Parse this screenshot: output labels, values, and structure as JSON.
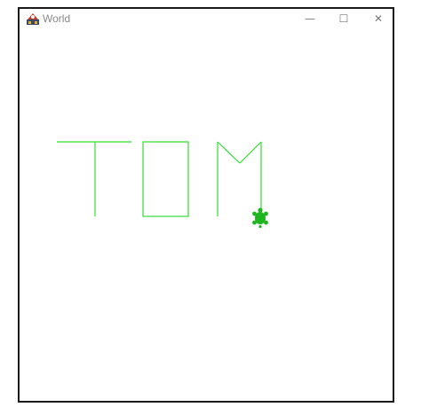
{
  "window": {
    "title": "World",
    "controls": {
      "minimize_glyph": "—",
      "maximize_glyph": "☐",
      "close_glyph": "✕"
    }
  },
  "canvas": {
    "background": "#ffffff",
    "pen_color": "#33dd33",
    "turtle": {
      "icon": "turtle-icon",
      "color": "#1fb51f"
    }
  }
}
